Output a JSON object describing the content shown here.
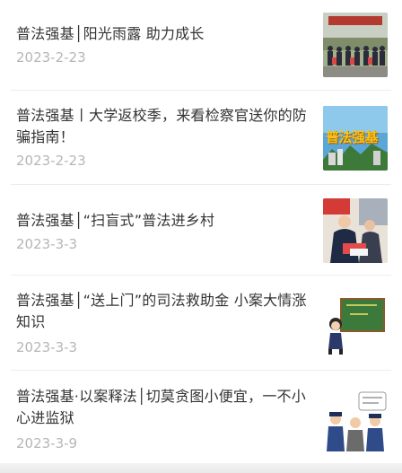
{
  "articles": [
    {
      "title": "普法强基│阳光雨露 助力成长",
      "date": "2023-2-23",
      "thumb_icon": "crowd-photo-thumbnail"
    },
    {
      "title": "普法强基丨大学返校季，来看检察官送你的防骗指南！",
      "date": "2023-2-23",
      "thumb_icon": "poster-thumbnail",
      "thumb_text": "普法强基"
    },
    {
      "title": "普法强基│“扫盲式”普法进乡村",
      "date": "2023-3-3",
      "thumb_icon": "village-outreach-photo-thumbnail"
    },
    {
      "title": "普法强基│“送上门”的司法救助金 小案大情涨知识",
      "date": "2023-3-3",
      "thumb_icon": "chalkboard-cartoon-thumbnail"
    },
    {
      "title": "普法强基·以案释法│切莫贪图小便宜，一不小心进监狱",
      "date": "2023-3-9",
      "thumb_icon": "cartoon-police-thumbnail"
    }
  ]
}
